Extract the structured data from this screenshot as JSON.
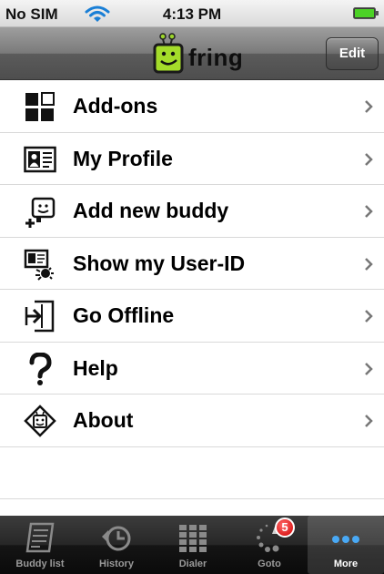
{
  "status": {
    "carrier": "No SIM",
    "time": "4:13 PM",
    "wifi_icon": "wifi-icon",
    "battery_icon": "battery-icon"
  },
  "navbar": {
    "logo_text": "fring",
    "edit_label": "Edit"
  },
  "menu": {
    "items": [
      {
        "label": "Add-ons",
        "icon": "addons-icon"
      },
      {
        "label": "My Profile",
        "icon": "profile-card-icon"
      },
      {
        "label": "Add new buddy",
        "icon": "add-buddy-icon"
      },
      {
        "label": "Show my User-ID",
        "icon": "user-id-icon"
      },
      {
        "label": "Go Offline",
        "icon": "go-offline-icon"
      },
      {
        "label": "Help",
        "icon": "help-icon"
      },
      {
        "label": "About",
        "icon": "about-icon"
      }
    ]
  },
  "tabbar": {
    "tabs": [
      {
        "label": "Buddy list",
        "icon": "buddy-list-icon"
      },
      {
        "label": "History",
        "icon": "history-icon"
      },
      {
        "label": "Dialer",
        "icon": "dialer-icon"
      },
      {
        "label": "Goto",
        "icon": "goto-icon",
        "badge": "5"
      },
      {
        "label": "More",
        "icon": "more-icon"
      }
    ],
    "active": "More"
  },
  "colors": {
    "accent_green": "#9bd42a",
    "badge_red": "#d10000"
  }
}
